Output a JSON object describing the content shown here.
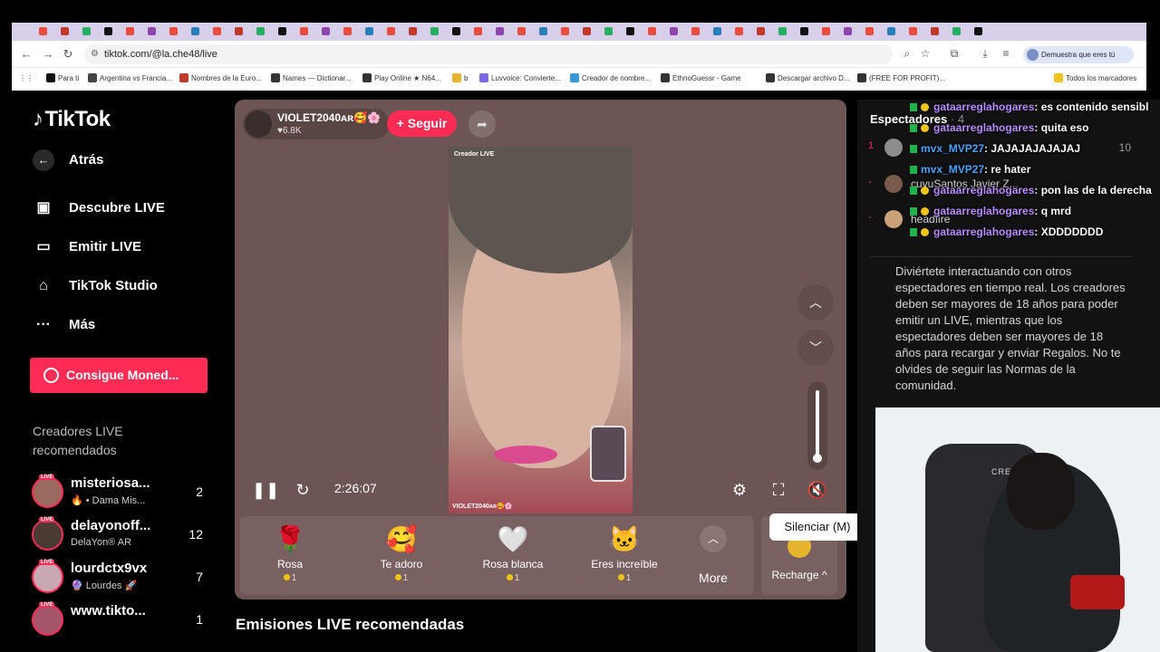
{
  "browser": {
    "url": "tiktok.com/@la.che48/live",
    "profile_label": "Demuestra que eres tú",
    "bookmarks": [
      "Para ti",
      "Argentina vs Francia...",
      "Nombres de la Euro...",
      "Names — Dictionar...",
      "Play Online ★ N64...",
      "b",
      "Luvvoice: Convierte...",
      "Creador de nombre...",
      "EthnoGuessr - Game",
      "Descargar archivo D...",
      "(FREE FOR PROFIT)...",
      "Todos los marcadores"
    ]
  },
  "sidebar": {
    "logo": "TikTok",
    "nav": [
      {
        "label": "Atrás",
        "icon": "back-arrow-icon"
      },
      {
        "label": "Descubre LIVE",
        "icon": "tv-icon"
      },
      {
        "label": "Emitir LIVE",
        "icon": "camera-icon"
      },
      {
        "label": "TikTok Studio",
        "icon": "studio-icon"
      },
      {
        "label": "Más",
        "icon": "more-dots-icon"
      }
    ],
    "coins_button": "Consigue Moned...",
    "recommended_title": "Creadores LIVE recomendados",
    "creators": [
      {
        "name": "misteriosa...",
        "sub": "🔥 • Dama Mis...",
        "count": "2"
      },
      {
        "name": "delayonoff...",
        "sub": "DelaYon® AR",
        "count": "12"
      },
      {
        "name": "lourdctx9vx",
        "sub": "🔮 Lourdes 🚀",
        "count": "7"
      },
      {
        "name": "www.tikto...",
        "sub": "",
        "count": "1"
      }
    ]
  },
  "player": {
    "host_name": "VIOLET2040ᴀʀ🥰🌸",
    "host_likes": "♥6.8K",
    "follow_label": "+ Seguir",
    "video_tag": "Creador LIVE",
    "video_caption": "VIOLET2040ᴀʀ🥰🌸",
    "time": "2:26:07",
    "tooltip": "Silenciar (M)",
    "gifts": [
      {
        "name": "Rosa",
        "price": "1",
        "glyph": "🌹"
      },
      {
        "name": "Te adoro",
        "price": "1",
        "glyph": "🥰"
      },
      {
        "name": "Rosa blanca",
        "price": "1",
        "glyph": "🤍"
      },
      {
        "name": "Eres increíble",
        "price": "1",
        "glyph": "🐱"
      }
    ],
    "more_label": "More",
    "recharge_label": "Recharge ^"
  },
  "bottom_title": "Emisiones LIVE recomendadas",
  "chat": {
    "spectators_title": "Espectadores",
    "spectators_count": "· 4",
    "viewers": [
      {
        "rank": "1",
        "name": "",
        "score": "10"
      },
      {
        "rank": "-",
        "name": "cuyuSantos Javier Z...",
        "score": ""
      },
      {
        "rank": "-",
        "name": "headfire",
        "score": ""
      }
    ],
    "messages": [
      {
        "user": "gataarreglahogares",
        "text": ": es contenido sensibl",
        "color": "purple"
      },
      {
        "user": "gataarreglahogares",
        "text": ": quita eso",
        "color": "purple"
      },
      {
        "user": "mvx_MVP27",
        "text": ": JAJAJAJAJAJAJ",
        "color": "blue"
      },
      {
        "user": "mvx_MVP27",
        "text": ": re hater",
        "color": "blue"
      },
      {
        "user": "gataarreglahogares",
        "text": ": pon las de la derecha",
        "color": "purple"
      },
      {
        "user": "gataarreglahogares",
        "text": ": q mrd",
        "color": "purple"
      },
      {
        "user": "gataarreglahogares",
        "text": ": XDDDDDDD",
        "color": "purple"
      }
    ],
    "disclaimer": "Diviértete interactuando con otros espectadores en tiempo real. Los creadores deben ser mayores de 18 años para poder emitir un LIVE, mientras que los espectadores deben ser mayores de 18 años para recargar y enviar Regalos. No te olvides de seguir las Normas de la comunidad."
  },
  "webcam": {
    "chair_brand": "CREA"
  }
}
